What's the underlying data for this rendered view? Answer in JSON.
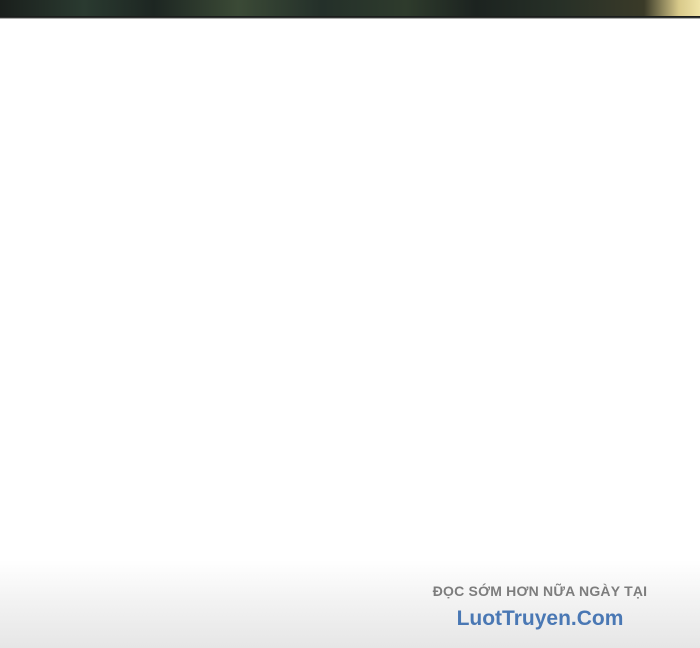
{
  "watermark": {
    "tagline": "ĐỌC SỚM HƠN NỮA NGÀY TẠI",
    "site": "LuotTruyen.Com"
  },
  "colors": {
    "background": "#ffffff",
    "tagline": "#7d7d7d",
    "site": "#4a78b4"
  }
}
